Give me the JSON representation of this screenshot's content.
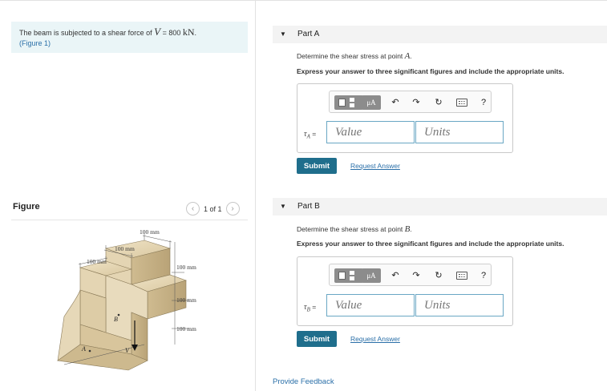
{
  "problem": {
    "text_before": "The beam is subjected to a shear force of",
    "variable": "V",
    "equals_value": "= 800",
    "unit": "kN",
    "period": ".",
    "figure_link": "(Figure 1)"
  },
  "figure": {
    "title": "Figure",
    "pager": "1 of 1",
    "prev_icon": "chevron-left-icon",
    "next_icon": "chevron-right-icon",
    "labels": {
      "top_right_dim": "100 mm",
      "top_mid_dim": "100 mm",
      "left_dim": "100 mm",
      "right_dim_1": "100 mm",
      "right_dim_2": "100 mm",
      "right_dim_3": "100 mm",
      "point_a": "A",
      "point_b": "B",
      "force_v": "V"
    }
  },
  "parts": [
    {
      "title": "Part A",
      "question_prefix": "Determine the shear stress at point",
      "point": "A",
      "question_suffix": ".",
      "instruction": "Express your answer to three significant figures and include the appropriate units.",
      "symbol": "τ",
      "symbol_sub": "A",
      "equals": "=",
      "value_placeholder": "Value",
      "units_placeholder": "Units",
      "mu_label": "μA",
      "help_label": "?",
      "submit_label": "Submit",
      "request_label": "Request Answer"
    },
    {
      "title": "Part B",
      "question_prefix": "Determine the shear stress at point",
      "point": "B",
      "question_suffix": ".",
      "instruction": "Express your answer to three significant figures and include the appropriate units.",
      "symbol": "τ",
      "symbol_sub": "B",
      "equals": "=",
      "value_placeholder": "Value",
      "units_placeholder": "Units",
      "mu_label": "μA",
      "help_label": "?",
      "submit_label": "Submit",
      "request_label": "Request Answer"
    }
  ],
  "feedback_label": "Provide Feedback",
  "colors": {
    "problem_bg": "#eaf5f7",
    "link": "#2a6fa8",
    "submit_bg": "#1f6e8c",
    "field_border": "#6aa7c4",
    "beam_face": "#e4d5b3"
  }
}
